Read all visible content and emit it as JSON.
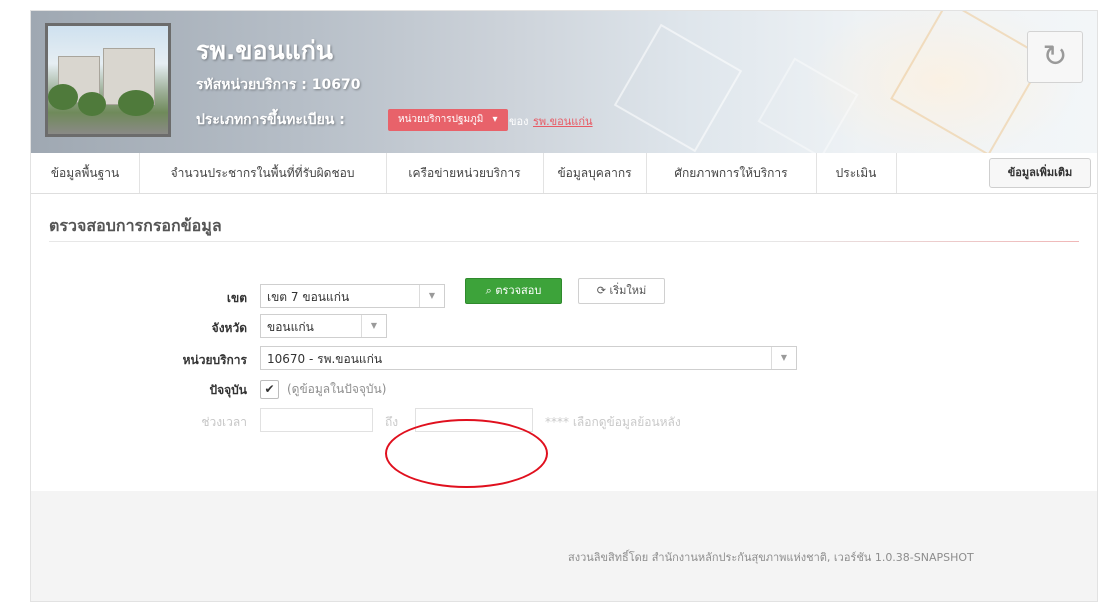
{
  "header": {
    "hospital_name": "รพ.ขอนแก่น",
    "service_code": "รหัสหน่วยบริการ : 10670",
    "registration_type_label": "ประเภทการขึ้นทะเบียน :",
    "registration_type_value": "หน่วยบริการปฐมภูมิ",
    "owner_label": "ของ",
    "owner_link": "รพ.ขอนแก่น",
    "refresh_icon": "refresh-icon"
  },
  "tabs": [
    {
      "label": "ข้อมูลพื้นฐาน"
    },
    {
      "label": "จำนวนประชากรในพื้นที่ที่รับผิดชอบ"
    },
    {
      "label": "เครือข่ายหน่วยบริการ"
    },
    {
      "label": "ข้อมูลบุคลากร"
    },
    {
      "label": "ศักยภาพการให้บริการ"
    },
    {
      "label": "ประเมิน"
    }
  ],
  "more_info_label": "ข้อมูลเพิ่มเติม",
  "form": {
    "section_title": "ตรวจสอบการกรอกข้อมูล",
    "zone_label": "เขต",
    "zone_value": "เขต 7 ขอนแก่น",
    "province_label": "จังหวัด",
    "province_value": "ขอนแก่น",
    "unit_label": "หน่วยบริการ",
    "unit_value": "10670 - รพ.ขอนแก่น",
    "current_label": "ปัจจุบัน",
    "current_checked": true,
    "current_hint": "(ดูข้อมูลในปัจจุบัน)",
    "period_label": "ช่วงเวลา",
    "period_to": "ถึง",
    "period_hint": "**** เลือกดูข้อมูลย้อนหลัง",
    "check_button": "ตรวจสอบ",
    "reset_button": "เริ่มใหม่"
  },
  "footer": {
    "text": "สงวนลิขสิทธิ์โดย สำนักงานหลักประกันสุขภาพแห่งชาติ, เวอร์ชัน 1.0.38-SNAPSHOT"
  },
  "colors": {
    "badge": "#e8626a",
    "check_button": "#3da33a",
    "annotation": "#e0101e"
  }
}
